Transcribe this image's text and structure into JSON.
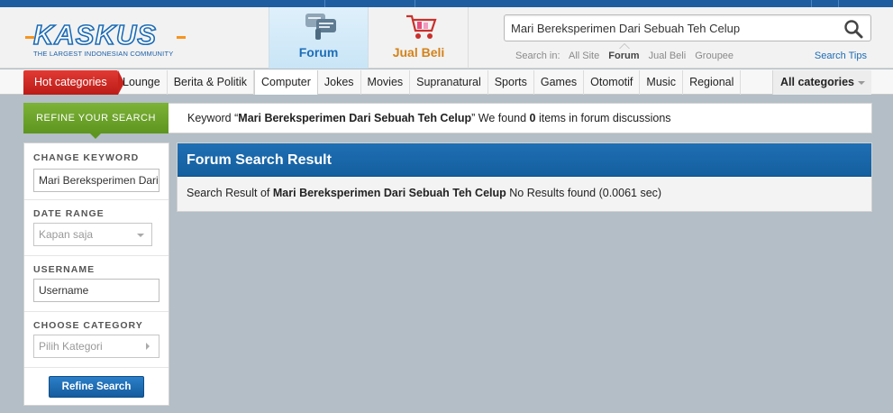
{
  "header": {
    "logo_text": "KASKUS",
    "logo_tagline": "THE LARGEST INDONESIAN COMMUNITY",
    "nav": [
      {
        "label": "Forum",
        "icon": "forum-icon",
        "active": true
      },
      {
        "label": "Jual Beli",
        "icon": "shopping-cart-icon",
        "active": false
      }
    ],
    "search": {
      "value": "Mari Bereksperimen Dari Sebuah Teh Celup",
      "search_in_label": "Search in:",
      "scopes": [
        "All Site",
        "Forum",
        "Jual Beli",
        "Groupee"
      ],
      "active_scope": "Forum",
      "tips_label": "Search Tips"
    }
  },
  "categories": {
    "hot_label": "Hot categories",
    "items": [
      "Lounge",
      "Berita & Politik",
      "Computer",
      "Jokes",
      "Movies",
      "Supranatural",
      "Sports",
      "Games",
      "Otomotif",
      "Music",
      "Regional"
    ],
    "active": "Computer",
    "all_label": "All categories"
  },
  "refine": {
    "tab_label": "REFINE YOUR SEARCH",
    "msg_prefix": "Keyword “",
    "keyword": "Mari Bereksperimen Dari Sebuah Teh Celup",
    "msg_middle": "” We found ",
    "count": "0",
    "msg_suffix": " items in forum discussions"
  },
  "sidebar": {
    "keyword_label": "CHANGE KEYWORD",
    "keyword_value": "Mari Bereksperimen Dari Sebuah Teh Celup",
    "date_label": "DATE RANGE",
    "date_value": "Kapan saja",
    "username_label": "USERNAME",
    "username_placeholder": "Username",
    "category_label": "CHOOSE CATEGORY",
    "category_value": "Pilih Kategori",
    "button_label": "Refine Search"
  },
  "result": {
    "title": "Forum Search Result",
    "prefix": "Search Result of ",
    "keyword": "Mari Bereksperimen Dari Sebuah Teh Celup",
    "suffix": " No Results found (0.0061 sec)"
  },
  "colors": {
    "brand_blue": "#1b6cb7",
    "brand_orange": "#f7941d",
    "hot_red": "#c9231e",
    "refine_green": "#6fa52b",
    "header_blue": "#1a68ab",
    "background": "#b3bec6"
  }
}
